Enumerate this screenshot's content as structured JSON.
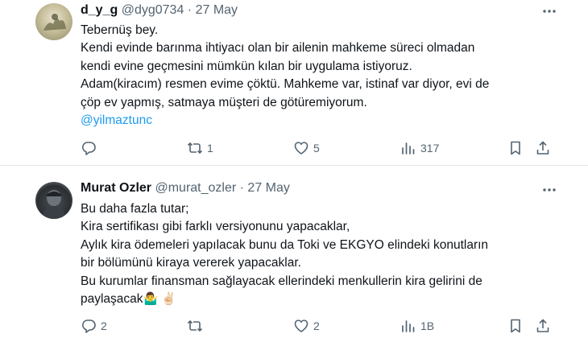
{
  "tweets": [
    {
      "name": "d_y_g",
      "handle": "@dyg0734",
      "separator": "·",
      "date": "27 May",
      "lines": [
        "Tebernüş bey.",
        "Kendi evinde barınma ihtiyacı olan bir ailenin mahkeme süreci olmadan",
        "kendi evine geçmesini mümkün kılan bir uygulama istiyoruz.",
        "Adam(kiracım) resmen evime çöktü. Mahkeme var, istinaf var diyor, evi de",
        "çöp ev yapmış, satmaya müşteri de götüremiyorum."
      ],
      "mention": "@yilmaztunc",
      "actions": {
        "reply": "",
        "retweet": "1",
        "like": "5",
        "views": "317"
      }
    },
    {
      "name": "Murat Ozler",
      "handle": "@murat_ozler",
      "separator": "·",
      "date": "27 May",
      "lines": [
        "Bu daha fazla tutar;",
        "Kira sertifikası gibi farklı versiyonunu yapacaklar,",
        "Aylık kira ödemeleri yapılacak bunu da Toki ve EKGYO elindeki konutların",
        "bir bölümünü kiraya vererek yapacaklar.",
        "Bu kurumlar finansman sağlayacak ellerindeki menkullerin kira gelirini de"
      ],
      "last_line": "paylaşacak",
      "emojis": "🤷‍♂️ ✌🏻",
      "actions": {
        "reply": "2",
        "retweet": "",
        "like": "2",
        "views": "1B"
      }
    }
  ],
  "icons": {
    "more": "more-horizontal-icon",
    "reply": "reply-icon",
    "retweet": "retweet-icon",
    "like": "heart-icon",
    "views": "views-icon",
    "bookmark": "bookmark-icon",
    "share": "share-icon"
  },
  "colors": {
    "text": "#0f1419",
    "secondary": "#536471",
    "mention": "#1d9bf0",
    "divider": "#e1e5e9"
  }
}
